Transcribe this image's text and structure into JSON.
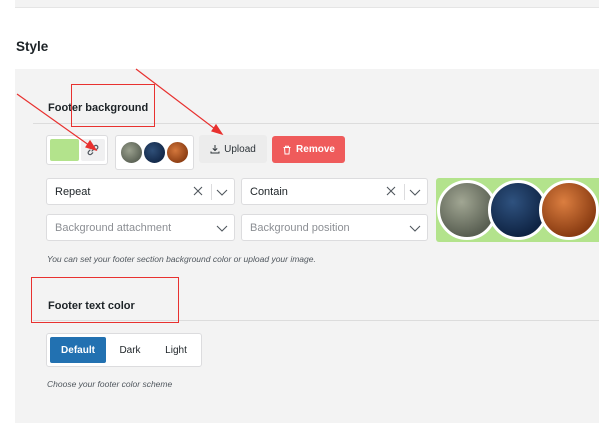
{
  "section": {
    "title": "Style"
  },
  "footer_background": {
    "label": "Footer background",
    "swatch_color": "#b3e38c",
    "link_icon": "link-icon",
    "upload_label": "Upload",
    "upload_icon": "download-icon",
    "remove_label": "Remove",
    "remove_icon": "trash-icon",
    "repeat": {
      "value": "Repeat"
    },
    "size": {
      "value": "Contain"
    },
    "attachment": {
      "placeholder": "Background attachment"
    },
    "position": {
      "placeholder": "Background position"
    },
    "help": "You can set your footer section background color or upload your image.",
    "preview_colors": [
      "#6f7468",
      "#1d3557",
      "#b4561f"
    ]
  },
  "footer_text_color": {
    "label": "Footer text color",
    "options": [
      "Default",
      "Dark",
      "Light"
    ],
    "selected": "Default",
    "accent": "#2271b1",
    "help": "Choose your footer color scheme"
  },
  "annotation_color": "#e8312f"
}
